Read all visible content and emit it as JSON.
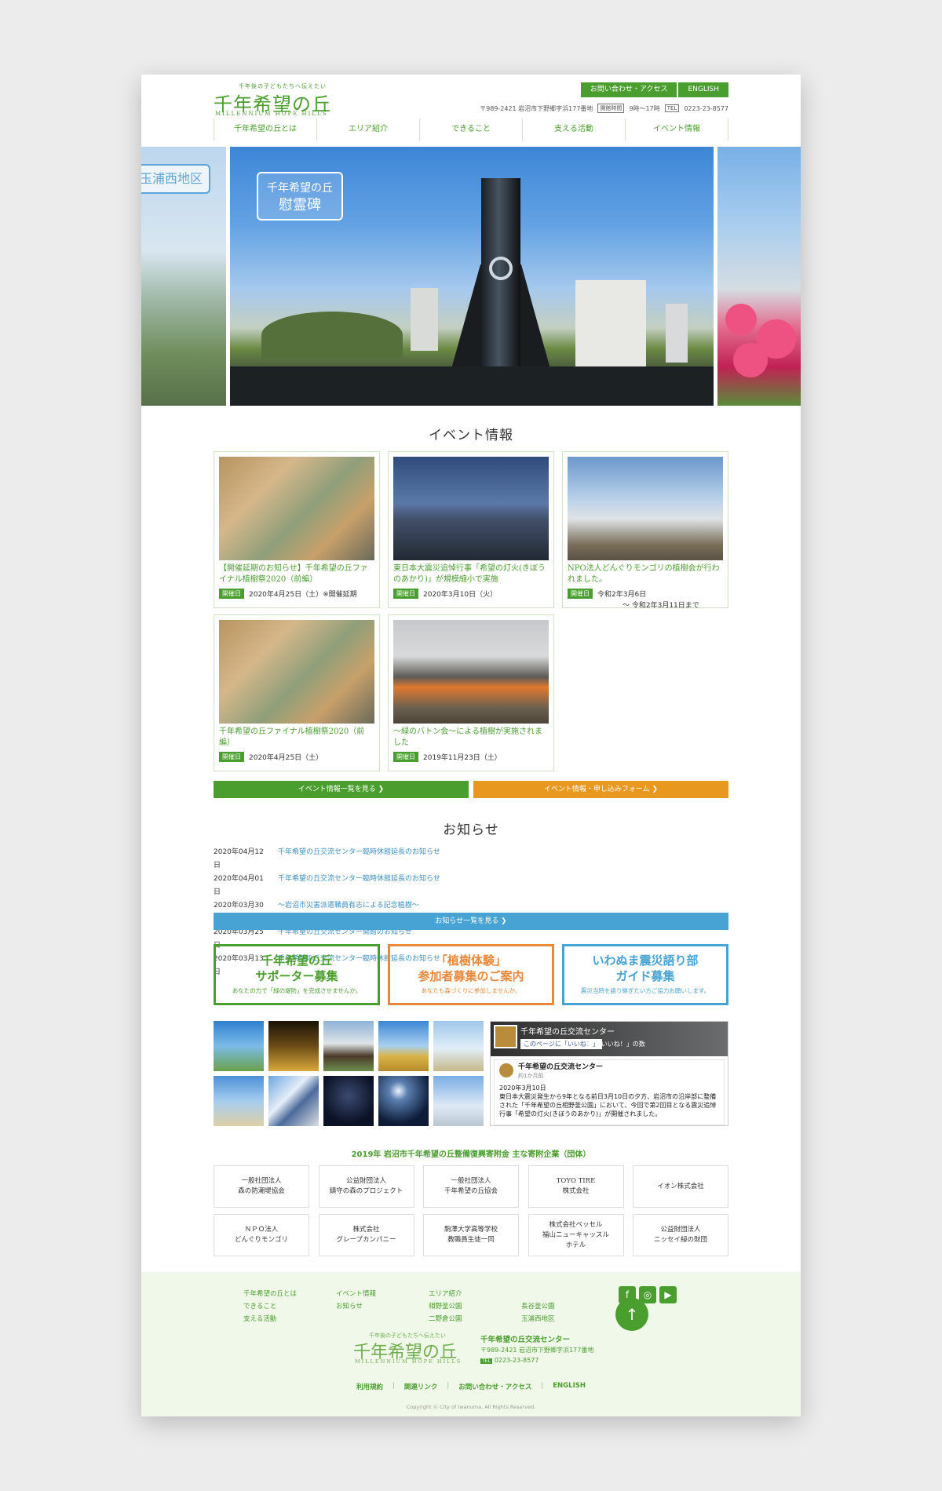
{
  "header": {
    "tagline": "千年後の子どもたちへ伝えたい",
    "logo": "千年希望の丘",
    "logo_en": "MILLENNIUM HOPE HILLS",
    "contact_btn": "お問い合わせ・アクセス",
    "english_btn": "ENGLISH",
    "address": "〒989-2421 岩沼市下野郷字浜177番地",
    "hours_label": "開館時間",
    "hours": "9時〜17時",
    "tel_label": "TEL",
    "tel": "0223-23-8577"
  },
  "nav": [
    "千年希望の丘とは",
    "エリア紹介",
    "できること",
    "支える活動",
    "イベント情報"
  ],
  "slider": {
    "left_label": "玉浦西地区",
    "main_label_1": "千年希望の丘",
    "main_label_2": "慰霊碑"
  },
  "events": {
    "title": "イベント情報",
    "items": [
      {
        "title": "【開催延期のお知らせ】千年希望の丘ファイナル植樹祭2020（前編）",
        "badge": "開催日",
        "date": "2020年4月25日（土）※開催延期",
        "date2": ""
      },
      {
        "title": "東日本大震災追悼行事「希望の灯火(きぼうのあかり)」が規模縮小で実施",
        "badge": "開催日",
        "date": "2020年3月10日（火）",
        "date2": ""
      },
      {
        "title": "NPO法人どんぐりモンゴリの植樹会が行われました。",
        "badge": "開催日",
        "date": "令和2年3月6日",
        "date2": "〜 令和2年3月11日まで"
      },
      {
        "title": "千年希望の丘ファイナル植樹祭2020（前編）",
        "badge": "開催日",
        "date": "2020年4月25日（土）",
        "date2": ""
      },
      {
        "title": "〜緑のバトン会〜による植樹が実施されました",
        "badge": "開催日",
        "date": "2019年11月23日（土）",
        "date2": ""
      }
    ],
    "list_btn": "イベント情報一覧を見る ❯",
    "form_btn": "イベント情報・申し込みフォーム ❯"
  },
  "news": {
    "title": "お知らせ",
    "items": [
      {
        "date": "2020年04月12日",
        "text": "千年希望の丘交流センター臨時休館延長のお知らせ"
      },
      {
        "date": "2020年04月01日",
        "text": "千年希望の丘交流センター臨時休館延長のお知らせ"
      },
      {
        "date": "2020年03月30日",
        "text": "〜岩沼市災害派遣職員有志による記念植樹〜"
      },
      {
        "date": "2020年03月25日",
        "text": "千年希望の丘交流センター開館のお知らせ"
      },
      {
        "date": "2020年03月13日",
        "text": "千年希望の丘交流センター臨時休館延長のお知らせ"
      }
    ],
    "list_btn": "お知らせ一覧を見る ❯"
  },
  "banners": [
    {
      "line1": "千年希望の丘",
      "line2": "サポーター募集",
      "sub": "あなたの力で「緑の堤防」を完成させませんか。",
      "color": "#4a9e2e"
    },
    {
      "line1": "「植樹体験」",
      "line2": "参加者募集のご案内",
      "sub": "あなたも森づくりに参加しませんか。",
      "color": "#e8883a"
    },
    {
      "line1": "いわぬま震災語り部",
      "line2": "ガイド募集",
      "sub": "震災当時を語り継ぎたい方ご協力お願いします。",
      "color": "#46a3d3"
    }
  ],
  "facebook": {
    "page_name": "千年希望の丘交流センター",
    "like_btn": "このページに「いいね！」",
    "like_count": "94 「いいね！」の数",
    "post_name": "千年希望の丘交流センター",
    "post_time": "約1か月前",
    "post_date": "2020年3月10日",
    "post_text": "東日本大震災発生から9年となる前日3月10日の夕方、岩沼市の沿岸部に整備された「千年希望の丘相野釜公園」において、今回で第2回目となる震災追悼行事「希望の灯火(きぼうのあかり)」が開催されました。"
  },
  "donors": {
    "title": "2019年 岩沼市千年希望の丘整備復興寄附金 主な寄附企業（団体）",
    "items": [
      "一般社団法人\n森の防潮堤協会",
      "公益財団法人\n鎮守の森のプロジェクト",
      "一般社団法人\n千年希望の丘協会",
      "TOYO TIRE\n株式会社",
      "イオン株式会社",
      "ＮＰＯ法人\nどんぐりモンゴリ",
      "株式会社\nグレープカンパニー",
      "駒澤大学高等学校\n教職員生徒一同",
      "株式会社ベッセル\n福山ニューキャッスル\nホテル",
      "公益財団法人\nニッセイ緑の財団"
    ]
  },
  "footer": {
    "col1": [
      "千年希望の丘とは",
      "できること",
      "支える活動"
    ],
    "col2": [
      "イベント情報",
      "お知らせ"
    ],
    "col3": [
      "エリア紹介",
      "相野釜公園",
      "二野倉公園"
    ],
    "col4": [
      "長谷釜公園",
      "玉浦西地区"
    ],
    "center_name": "千年希望の丘交流センター",
    "address": "〒989-2421 岩沼市下野郷字浜177番地",
    "tel_label": "TEL",
    "tel": "0223-23-8577",
    "links": [
      "利用規約",
      "関連リンク",
      "お問い合わせ・アクセス",
      "ENGLISH"
    ],
    "copyright": "Copyright © City of Iwanuma. All Rights Reserved."
  },
  "icons": [
    "facebook-icon",
    "instagram-icon",
    "youtube-icon",
    "arrow-up-icon"
  ]
}
